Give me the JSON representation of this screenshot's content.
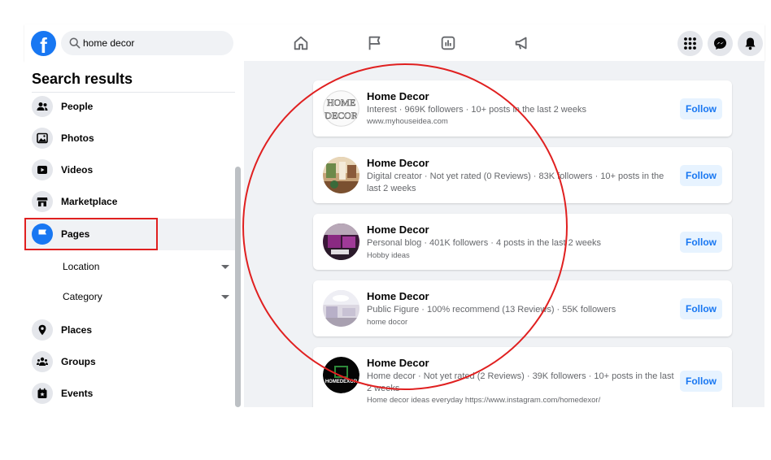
{
  "topbar": {
    "logo_icon": "facebook-logo",
    "logo_letter": "f",
    "search_value": "home decor",
    "search_icon": "search-icon",
    "nav_icons": [
      "home-icon",
      "flag-icon",
      "dashboard-icon",
      "megaphone-icon"
    ],
    "right_icons": [
      "menu-grid-icon",
      "messenger-icon",
      "bell-icon"
    ]
  },
  "sidebar": {
    "title": "Search results",
    "items": [
      {
        "label": "People",
        "icon": "people-icon"
      },
      {
        "label": "Photos",
        "icon": "photos-icon"
      },
      {
        "label": "Videos",
        "icon": "videos-icon"
      },
      {
        "label": "Marketplace",
        "icon": "marketplace-icon"
      },
      {
        "label": "Pages",
        "icon": "flag-icon"
      }
    ],
    "filters": [
      {
        "label": "Location"
      },
      {
        "label": "Category"
      }
    ],
    "more_items": [
      {
        "label": "Places",
        "icon": "place-icon"
      },
      {
        "label": "Groups",
        "icon": "groups-icon"
      },
      {
        "label": "Events",
        "icon": "events-icon"
      }
    ]
  },
  "results": [
    {
      "name": "Home Decor",
      "meta": "Interest · 969K followers · 10+ posts in the last 2 weeks",
      "sub": "www.myhouseidea.com",
      "follow_label": "Follow",
      "avatar_text": "HOME DECOR"
    },
    {
      "name": "Home Decor",
      "meta": "Digital creator · Not yet rated (0 Reviews) · 83K followers · 10+ posts in the last 2 weeks",
      "sub": "",
      "follow_label": "Follow"
    },
    {
      "name": "Home Decor",
      "meta": "Personal blog · 401K followers · 4 posts in the last 2 weeks",
      "sub": "Hobby ideas",
      "follow_label": "Follow"
    },
    {
      "name": "Home Decor",
      "meta": "Public Figure · 100% recommend (13 Reviews) · 55K followers",
      "sub": "home docor",
      "follow_label": "Follow"
    },
    {
      "name": "Home Decor",
      "meta": "Home decor · Not yet rated (2 Reviews) · 39K followers · 10+ posts in the last 2 weeks",
      "sub": "Home decor ideas everyday https://www.instagram.com/homedexor/",
      "follow_label": "Follow",
      "avatar_text": "HOMEDEXOR"
    }
  ],
  "colors": {
    "accent": "#1877f2",
    "annotation": "#e02020",
    "background": "#f0f2f5"
  }
}
